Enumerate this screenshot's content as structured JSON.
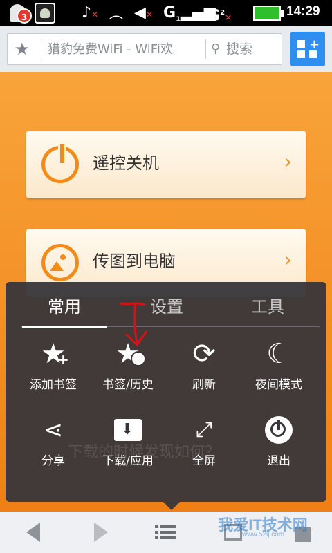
{
  "status_bar": {
    "notification_count": "3",
    "signal_1": "G",
    "signal_1_sub": "1",
    "signal_2": "G",
    "signal_2_sub": "2",
    "time": "14:29"
  },
  "address_bar": {
    "page_title": "猎豹免费WiFi - WiFi欢",
    "search_label": "搜索"
  },
  "cards": [
    {
      "label": "遥控关机"
    },
    {
      "label": "传图到电脑"
    }
  ],
  "menu": {
    "tabs": [
      {
        "label": "常用",
        "active": true
      },
      {
        "label": "设置",
        "active": false
      },
      {
        "label": "工具",
        "active": false
      }
    ],
    "items": [
      {
        "label": "添加书签",
        "icon": "star-plus-icon"
      },
      {
        "label": "书签/历史",
        "icon": "star-clock-icon"
      },
      {
        "label": "刷新",
        "icon": "refresh-icon"
      },
      {
        "label": "夜间模式",
        "icon": "moon-icon"
      },
      {
        "label": "分享",
        "icon": "share-icon"
      },
      {
        "label": "下载/应用",
        "icon": "download-folder-icon"
      },
      {
        "label": "全屏",
        "icon": "fullscreen-icon"
      },
      {
        "label": "退出",
        "icon": "power-icon"
      }
    ]
  },
  "background_text": "下载的时候发现如何？",
  "watermark": {
    "text": "我爱IT技术网",
    "url": "www.52ij.com"
  },
  "colors": {
    "accent_orange": "#f28b19",
    "menu_bg": "#38363a",
    "grid_button": "#2e8ff0",
    "annotation_red": "#d0141a"
  }
}
